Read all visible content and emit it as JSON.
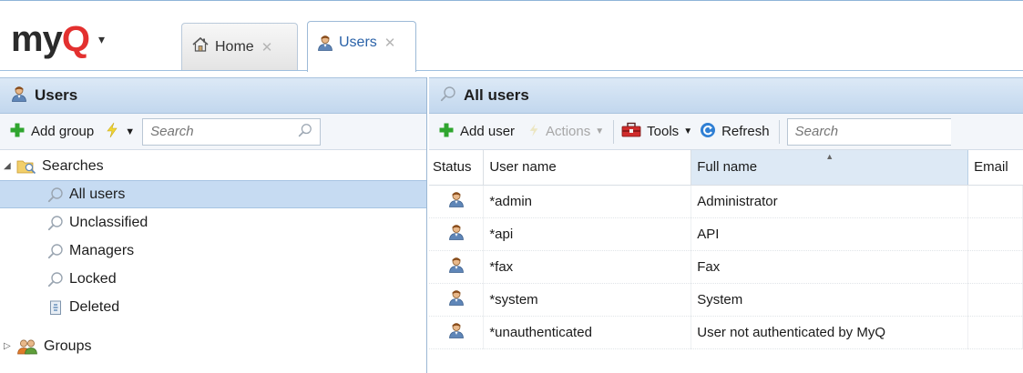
{
  "app": {
    "logo_prefix": "my",
    "logo_q": "Q",
    "logo_caret": "▾"
  },
  "tabs": [
    {
      "label": "Home",
      "icon": "home-icon",
      "active": false
    },
    {
      "label": "Users",
      "icon": "user-icon",
      "active": true
    }
  ],
  "left": {
    "header": "Users",
    "toolbar": {
      "add_group": "Add group",
      "search_placeholder": "Search"
    },
    "tree": [
      {
        "label": "Searches",
        "icon": "folder-search-icon",
        "expanded": true,
        "level": 0
      },
      {
        "label": "All users",
        "icon": "search-icon",
        "selected": true,
        "level": 1
      },
      {
        "label": "Unclassified",
        "icon": "search-icon",
        "level": 1
      },
      {
        "label": "Managers",
        "icon": "search-icon",
        "level": 1
      },
      {
        "label": "Locked",
        "icon": "search-icon",
        "level": 1
      },
      {
        "label": "Deleted",
        "icon": "recycle-bin-icon",
        "level": 1
      },
      {
        "label": "Groups",
        "icon": "group-icon",
        "expanded": false,
        "level": 0
      }
    ]
  },
  "right": {
    "header": "All users",
    "toolbar": {
      "add_user": "Add user",
      "actions": "Actions",
      "tools": "Tools",
      "refresh": "Refresh",
      "search_placeholder": "Search"
    },
    "columns": [
      "Status",
      "User name",
      "Full name",
      "Email"
    ],
    "sorted_column": "Full name",
    "rows": [
      {
        "status_icon": "user-icon",
        "user_name": "*admin",
        "full_name": "Administrator",
        "email": ""
      },
      {
        "status_icon": "user-icon",
        "user_name": "*api",
        "full_name": "API",
        "email": ""
      },
      {
        "status_icon": "user-icon",
        "user_name": "*fax",
        "full_name": "Fax",
        "email": ""
      },
      {
        "status_icon": "user-icon",
        "user_name": "*system",
        "full_name": "System",
        "email": ""
      },
      {
        "status_icon": "user-icon",
        "user_name": "*unauthenticated",
        "full_name": "User not authenticated by MyQ",
        "email": ""
      }
    ]
  },
  "colors": {
    "brand_red": "#e3302f",
    "header_blue": "#c2d7ee",
    "selected_row": "#c6dbf2",
    "add_green": "#2fa52f",
    "refresh_blue": "#2f7fd4"
  }
}
